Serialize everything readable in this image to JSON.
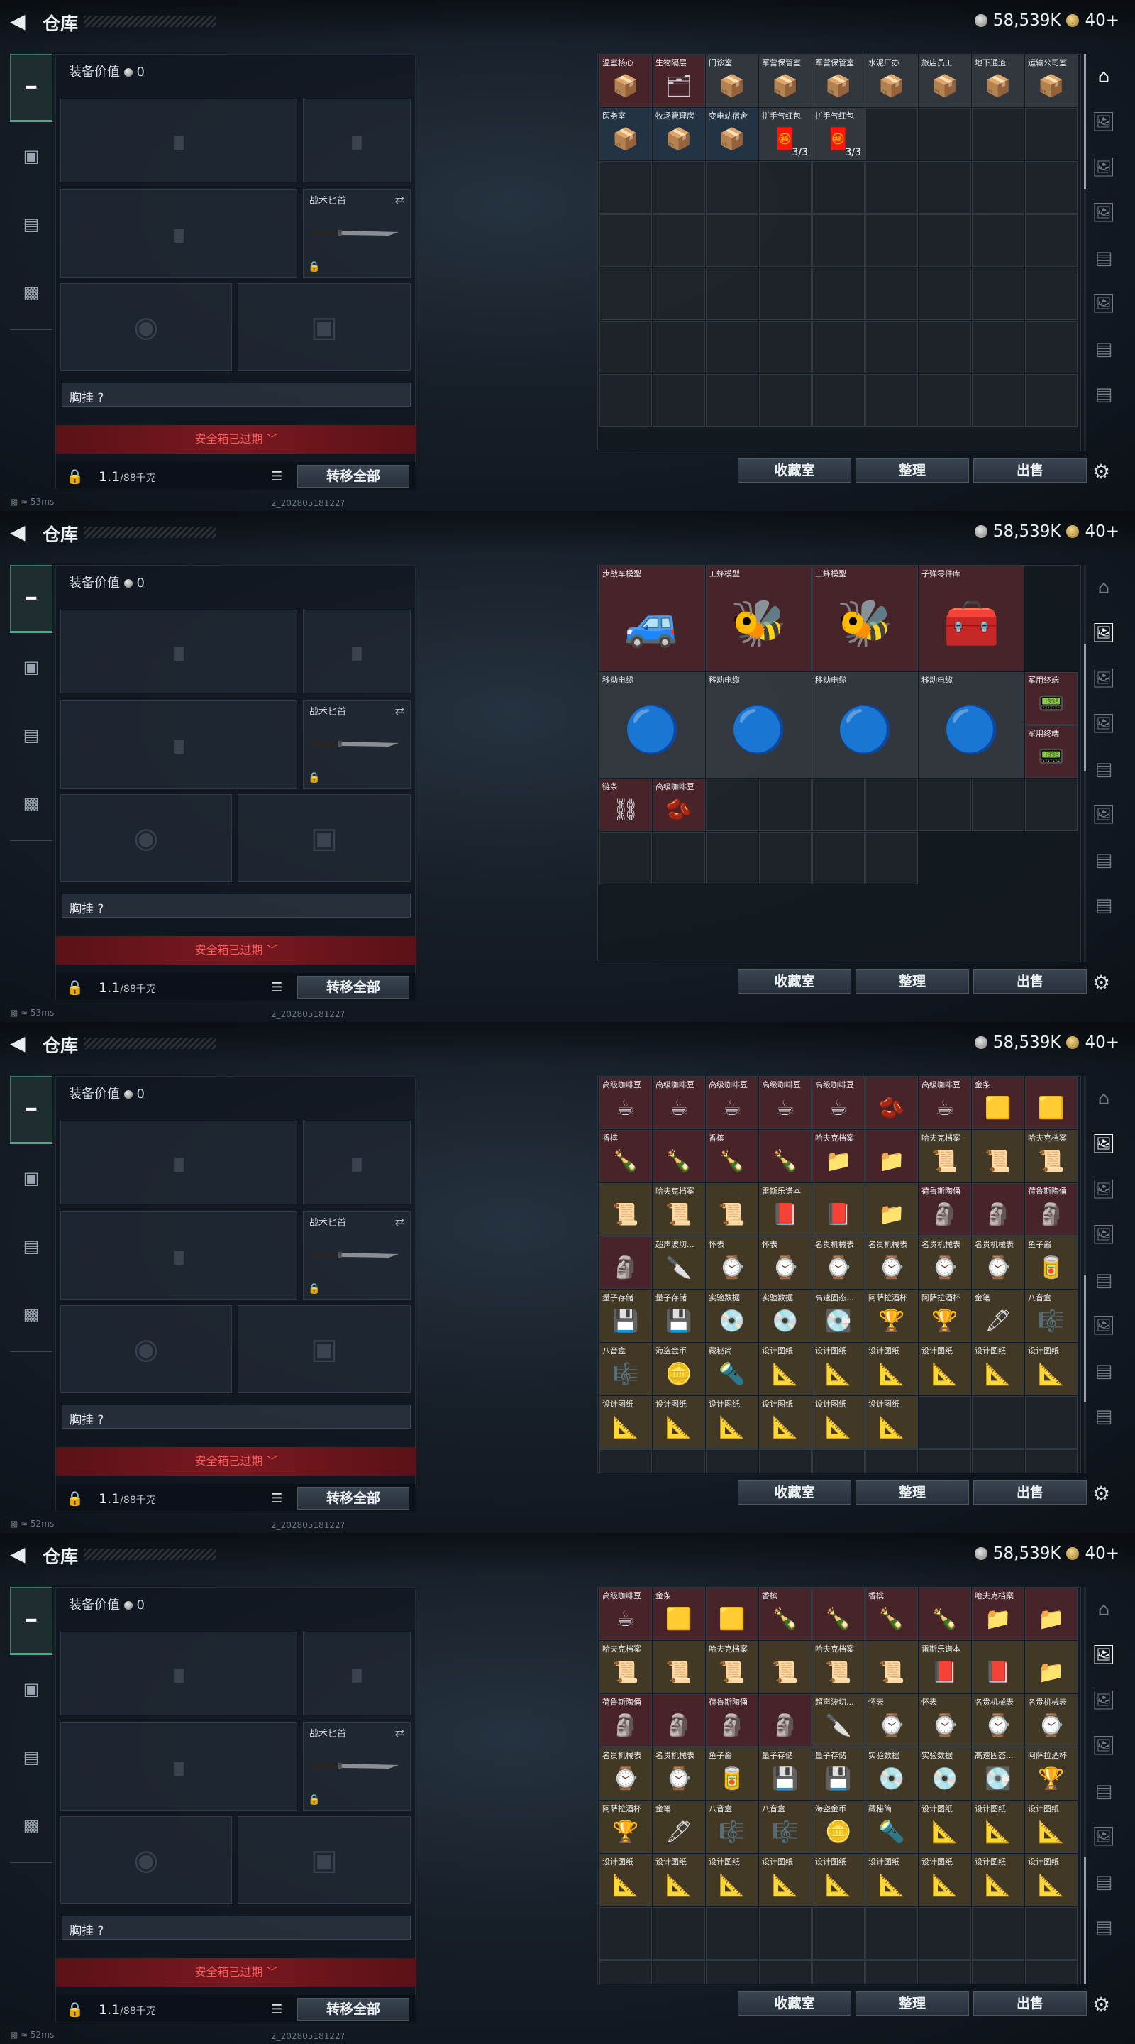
{
  "header": {
    "back_icon": "back-arrow-icon",
    "title": "仓库",
    "silver": "58,539K",
    "gold": "40+"
  },
  "left_nav": [
    {
      "icon": "pistol-icon"
    },
    {
      "icon": "vest-icon"
    },
    {
      "icon": "clipboard-icon"
    },
    {
      "icon": "briefcase-icon"
    }
  ],
  "equipment": {
    "value_label": "装备价值",
    "value": "0",
    "knife_label": "战术匕首",
    "chest_label": "胸挂 ?",
    "safe_box": "安全箱已过期 ﹀",
    "weight": "1.1",
    "weight_max": "/88千克",
    "transfer_all": "转移全部"
  },
  "status": {
    "ping0": "53ms",
    "ping1": "53ms",
    "ping2": "52ms",
    "ping3": "52ms",
    "version": "2_20280518122?"
  },
  "bottom": {
    "collection": "收藏室",
    "sort": "整理",
    "sell": "出售"
  },
  "panels": [
    {
      "title": "仓库",
      "items": [
        {
          "n": "温室核心",
          "c": "red",
          "i": "📦"
        },
        {
          "n": "生物隔层",
          "c": "red",
          "i": "🗂"
        },
        {
          "n": "门诊室",
          "c": "gray",
          "i": "📦"
        },
        {
          "n": "军营保管室",
          "c": "gray",
          "i": "📦"
        },
        {
          "n": "军营保管室",
          "c": "gray",
          "i": "📦"
        },
        {
          "n": "水泥厂办",
          "c": "gray",
          "i": "📦"
        },
        {
          "n": "旅店员工",
          "c": "gray",
          "i": "📦"
        },
        {
          "n": "地下通道",
          "c": "gray",
          "i": "📦"
        },
        {
          "n": "运输公司室",
          "c": "gray",
          "i": "📦"
        },
        {
          "n": "医务室",
          "c": "blue",
          "i": "📦"
        },
        {
          "n": "牧场管理房",
          "c": "blue",
          "i": "📦"
        },
        {
          "n": "变电站宿舍",
          "c": "blue",
          "i": "📦"
        },
        {
          "n": "拼手气红包",
          "c": "gray",
          "i": "🧧",
          "cnt": "3/3"
        },
        {
          "n": "拼手气红包",
          "c": "gray",
          "i": "🧧",
          "cnt": "3/3"
        }
      ]
    },
    {
      "title": "仓库",
      "items": [
        {
          "n": "步战车模型",
          "c": "red",
          "i": "🚙",
          "big": 1
        },
        {
          "n": "工蜂模型",
          "c": "red",
          "i": "🐝",
          "big": 1
        },
        {
          "n": "工蜂模型",
          "c": "red",
          "i": "🐝",
          "big": 1
        },
        {
          "n": "子弹零件库",
          "c": "red",
          "i": "🧰",
          "big": 1
        },
        {
          "n": "移动电缆",
          "c": "gray",
          "i": "🔵",
          "big": 1
        },
        {
          "n": "移动电缆",
          "c": "gray",
          "i": "🔵",
          "big": 1
        },
        {
          "n": "移动电缆",
          "c": "gray",
          "i": "🔵",
          "big": 1
        },
        {
          "n": "移动电缆",
          "c": "gray",
          "i": "🔵",
          "big": 1
        },
        {
          "n": "军用终端",
          "c": "red",
          "i": "📟"
        },
        {
          "n": "军用终端",
          "c": "red",
          "i": "📟"
        },
        {
          "n": "链条",
          "c": "red",
          "i": "⛓"
        },
        {
          "n": "高级咖啡豆",
          "c": "red",
          "i": "🫘"
        }
      ]
    },
    {
      "title": "仓库",
      "items": [
        {
          "n": "高级咖啡豆",
          "c": "red",
          "i": "☕"
        },
        {
          "n": "高级咖啡豆",
          "c": "red",
          "i": "☕"
        },
        {
          "n": "高级咖啡豆",
          "c": "red",
          "i": "☕"
        },
        {
          "n": "高级咖啡豆",
          "c": "red",
          "i": "☕"
        },
        {
          "n": "高级咖啡豆",
          "c": "red",
          "i": "☕"
        },
        {
          "n": "",
          "c": "red",
          "i": "🫘"
        },
        {
          "n": "高级咖啡豆",
          "c": "red",
          "i": "☕"
        },
        {
          "n": "金条",
          "c": "red",
          "i": "🟨"
        },
        {
          "n": "",
          "c": "red",
          "i": "🟨"
        },
        {
          "n": "香槟",
          "c": "red",
          "i": "🍾"
        },
        {
          "n": "",
          "c": "red",
          "i": "🍾"
        },
        {
          "n": "香槟",
          "c": "red",
          "i": "🍾"
        },
        {
          "n": "",
          "c": "red",
          "i": "🍾"
        },
        {
          "n": "哈夫克档案",
          "c": "red",
          "i": "📁"
        },
        {
          "n": "",
          "c": "red",
          "i": "📁"
        },
        {
          "n": "哈夫克档案",
          "c": "gold",
          "i": "📜"
        },
        {
          "n": "",
          "c": "gold",
          "i": "📜"
        },
        {
          "n": "哈夫克档案",
          "c": "gold",
          "i": "📜"
        },
        {
          "n": "",
          "c": "gold",
          "i": "📜"
        },
        {
          "n": "哈夫克档案",
          "c": "gold",
          "i": "📜"
        },
        {
          "n": "",
          "c": "gold",
          "i": "📜"
        },
        {
          "n": "雷斯乐谱本",
          "c": "gold",
          "i": "📕"
        },
        {
          "n": "",
          "c": "gold",
          "i": "📕"
        },
        {
          "n": "",
          "c": "gold",
          "i": "📁"
        },
        {
          "n": "荷鲁斯陶俑",
          "c": "red",
          "i": "🗿"
        },
        {
          "n": "",
          "c": "red",
          "i": "🗿"
        },
        {
          "n": "荷鲁斯陶俑",
          "c": "red",
          "i": "🗿"
        },
        {
          "n": "",
          "c": "red",
          "i": "🗿"
        },
        {
          "n": "超声波切...",
          "c": "gold",
          "i": "🔪"
        },
        {
          "n": "怀表",
          "c": "gold",
          "i": "⌚"
        },
        {
          "n": "怀表",
          "c": "gold",
          "i": "⌚"
        },
        {
          "n": "名贵机械表",
          "c": "gold",
          "i": "⌚"
        },
        {
          "n": "名贵机械表",
          "c": "gold",
          "i": "⌚"
        },
        {
          "n": "名贵机械表",
          "c": "gold",
          "i": "⌚"
        },
        {
          "n": "名贵机械表",
          "c": "gold",
          "i": "⌚"
        },
        {
          "n": "鱼子酱",
          "c": "gold",
          "i": "🥫"
        },
        {
          "n": "量子存储",
          "c": "gold",
          "i": "💾"
        },
        {
          "n": "量子存储",
          "c": "gold",
          "i": "💾"
        },
        {
          "n": "实验数据",
          "c": "gold",
          "i": "💿"
        },
        {
          "n": "实验数据",
          "c": "gold",
          "i": "💿"
        },
        {
          "n": "高速固态...",
          "c": "gold",
          "i": "💽"
        },
        {
          "n": "阿萨拉酒杯",
          "c": "gold",
          "i": "🏆"
        },
        {
          "n": "阿萨拉酒杯",
          "c": "gold",
          "i": "🏆"
        },
        {
          "n": "金笔",
          "c": "gold",
          "i": "🖋"
        },
        {
          "n": "八音盒",
          "c": "gold",
          "i": "🎼"
        },
        {
          "n": "八音盒",
          "c": "gold",
          "i": "🎼"
        },
        {
          "n": "海盗金币",
          "c": "gold",
          "i": "🪙"
        },
        {
          "n": "藏秘简",
          "c": "gold",
          "i": "🔦"
        },
        {
          "n": "设计图纸",
          "c": "gold",
          "i": "📐"
        },
        {
          "n": "设计图纸",
          "c": "gold",
          "i": "📐"
        },
        {
          "n": "设计图纸",
          "c": "gold",
          "i": "📐"
        },
        {
          "n": "设计图纸",
          "c": "gold",
          "i": "📐"
        },
        {
          "n": "设计图纸",
          "c": "gold",
          "i": "📐"
        },
        {
          "n": "设计图纸",
          "c": "gold",
          "i": "📐"
        },
        {
          "n": "设计图纸",
          "c": "gold",
          "i": "📐"
        },
        {
          "n": "设计图纸",
          "c": "gold",
          "i": "📐"
        },
        {
          "n": "设计图纸",
          "c": "gold",
          "i": "📐"
        },
        {
          "n": "设计图纸",
          "c": "gold",
          "i": "📐"
        },
        {
          "n": "设计图纸",
          "c": "gold",
          "i": "📐"
        },
        {
          "n": "设计图纸",
          "c": "gold",
          "i": "📐"
        }
      ]
    },
    {
      "title": "仓库",
      "items": [
        {
          "n": "高级咖啡豆",
          "c": "red",
          "i": "☕"
        },
        {
          "n": "金条",
          "c": "red",
          "i": "🟨"
        },
        {
          "n": "",
          "c": "red",
          "i": "🟨"
        },
        {
          "n": "香槟",
          "c": "red",
          "i": "🍾"
        },
        {
          "n": "",
          "c": "red",
          "i": "🍾"
        },
        {
          "n": "香槟",
          "c": "red",
          "i": "🍾"
        },
        {
          "n": "",
          "c": "red",
          "i": "🍾"
        },
        {
          "n": "哈夫克档案",
          "c": "red",
          "i": "📁"
        },
        {
          "n": "",
          "c": "red",
          "i": "📁"
        },
        {
          "n": "哈夫克档案",
          "c": "gold",
          "i": "📜"
        },
        {
          "n": "",
          "c": "gold",
          "i": "📜"
        },
        {
          "n": "哈夫克档案",
          "c": "gold",
          "i": "📜"
        },
        {
          "n": "",
          "c": "gold",
          "i": "📜"
        },
        {
          "n": "哈夫克档案",
          "c": "gold",
          "i": "📜"
        },
        {
          "n": "",
          "c": "gold",
          "i": "📜"
        },
        {
          "n": "雷斯乐谱本",
          "c": "gold",
          "i": "📕"
        },
        {
          "n": "",
          "c": "gold",
          "i": "📕"
        },
        {
          "n": "",
          "c": "gold",
          "i": "📁"
        },
        {
          "n": "荷鲁斯陶俑",
          "c": "red",
          "i": "🗿"
        },
        {
          "n": "",
          "c": "red",
          "i": "🗿"
        },
        {
          "n": "荷鲁斯陶俑",
          "c": "red",
          "i": "🗿"
        },
        {
          "n": "",
          "c": "red",
          "i": "🗿"
        },
        {
          "n": "超声波切...",
          "c": "gold",
          "i": "🔪"
        },
        {
          "n": "怀表",
          "c": "gold",
          "i": "⌚"
        },
        {
          "n": "怀表",
          "c": "gold",
          "i": "⌚"
        },
        {
          "n": "名贵机械表",
          "c": "gold",
          "i": "⌚"
        },
        {
          "n": "名贵机械表",
          "c": "gold",
          "i": "⌚"
        },
        {
          "n": "名贵机械表",
          "c": "gold",
          "i": "⌚"
        },
        {
          "n": "名贵机械表",
          "c": "gold",
          "i": "⌚"
        },
        {
          "n": "鱼子酱",
          "c": "gold",
          "i": "🥫"
        },
        {
          "n": "量子存储",
          "c": "gold",
          "i": "💾"
        },
        {
          "n": "量子存储",
          "c": "gold",
          "i": "💾"
        },
        {
          "n": "实验数据",
          "c": "gold",
          "i": "💿"
        },
        {
          "n": "实验数据",
          "c": "gold",
          "i": "💿"
        },
        {
          "n": "高速固态...",
          "c": "gold",
          "i": "💽"
        },
        {
          "n": "阿萨拉酒杯",
          "c": "gold",
          "i": "🏆"
        },
        {
          "n": "阿萨拉酒杯",
          "c": "gold",
          "i": "🏆"
        },
        {
          "n": "金笔",
          "c": "gold",
          "i": "🖋"
        },
        {
          "n": "八音盒",
          "c": "gold",
          "i": "🎼"
        },
        {
          "n": "八音盒",
          "c": "gold",
          "i": "🎼"
        },
        {
          "n": "海盗金币",
          "c": "gold",
          "i": "🪙"
        },
        {
          "n": "藏秘简",
          "c": "gold",
          "i": "🔦"
        },
        {
          "n": "设计图纸",
          "c": "gold",
          "i": "📐"
        },
        {
          "n": "设计图纸",
          "c": "gold",
          "i": "📐"
        },
        {
          "n": "设计图纸",
          "c": "gold",
          "i": "📐"
        },
        {
          "n": "设计图纸",
          "c": "gold",
          "i": "📐"
        },
        {
          "n": "设计图纸",
          "c": "gold",
          "i": "📐"
        },
        {
          "n": "设计图纸",
          "c": "gold",
          "i": "📐"
        },
        {
          "n": "设计图纸",
          "c": "gold",
          "i": "📐"
        },
        {
          "n": "设计图纸",
          "c": "gold",
          "i": "📐"
        },
        {
          "n": "设计图纸",
          "c": "gold",
          "i": "📐"
        },
        {
          "n": "设计图纸",
          "c": "gold",
          "i": "📐"
        },
        {
          "n": "设计图纸",
          "c": "gold",
          "i": "📐"
        },
        {
          "n": "设计图纸",
          "c": "gold",
          "i": "📐"
        }
      ]
    }
  ]
}
